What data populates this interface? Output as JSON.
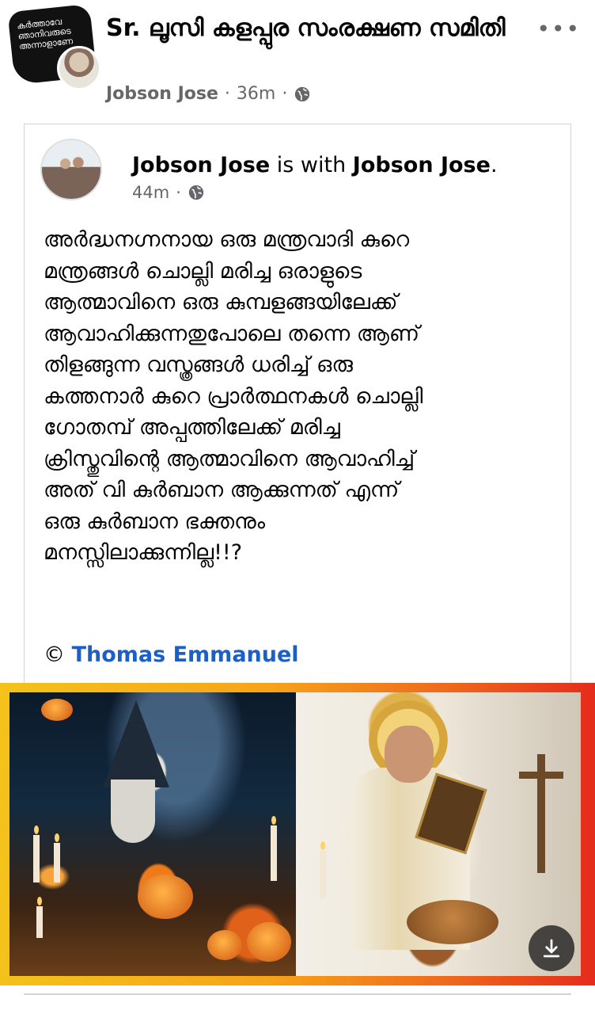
{
  "post": {
    "group_name": "Sr. ലൂസി കളപ്പുര സംരക്ഷണ സമിതി",
    "author": "Jobson Jose",
    "time": "36m",
    "separator": "·",
    "more_label": "•••",
    "avatar_text": [
      "കർത്താവേ",
      "ഞാനിവരുടെ",
      "അന്നാളാണേ"
    ],
    "globe_icon": "globe-icon"
  },
  "shared": {
    "author": "Jobson Jose",
    "with_text": "is with",
    "tagged": "Jobson Jose",
    "period": ".",
    "time": "44m",
    "separator": "·",
    "text": "അർദ്ധനഗ്നനായ ഒരു മന്ത്രവാദി കുറെ\nമന്ത്രങ്ങൾ ചൊല്ലി മരിച്ച ഒരാളുടെ\nആത്മാവിനെ ഒരു കുമ്പളങ്ങയിലേക്ക്\nആവാഹിക്കുന്നതുപോലെ തന്നെ ആണ്\nതിളങ്ങുന്ന വസ്ത്രങ്ങൾ ധരിച്ച് ഒരു\nകത്തനാർ കുറെ പ്രാർത്ഥനകൾ ചൊല്ലി\nഗോതമ്പ് അപ്പത്തിലേക്ക് മരിച്ച\nക്രിസ്തുവിന്റെ ആത്മാവിനെ ആവാഹിച്ച്\nഅത് വി കുർബാന ആക്കുന്നത് എന്ന്\nഒരു കുർബാന ഭക്തനും\nമനസ്സിലാക്കുന്നില്ല!!?",
    "credit_symbol": "©",
    "credit_name": "Thomas Emmanuel"
  },
  "image": {
    "left_subject": "wizard-with-pumpkin",
    "right_subject": "priest-with-bread",
    "frame_colors": [
      "#f4c21b",
      "#e52c1c"
    ],
    "download_icon": "download-icon"
  }
}
